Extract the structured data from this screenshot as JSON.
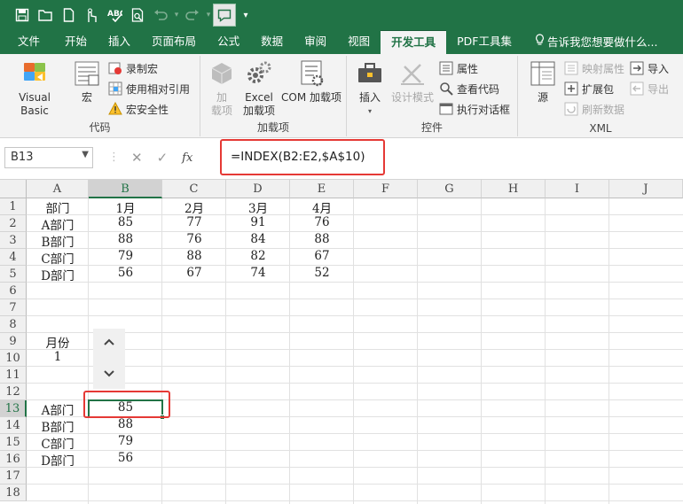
{
  "quick_access": {
    "icons": [
      "save-icon",
      "open-folder-icon",
      "new-file-icon",
      "touch-mode-icon",
      "spellcheck-icon",
      "print-preview-icon",
      "undo-icon",
      "redo-icon",
      "comment-icon",
      "customize-icon"
    ]
  },
  "ribbon_tabs": [
    {
      "label": "文件"
    },
    {
      "label": "开始"
    },
    {
      "label": "插入"
    },
    {
      "label": "页面布局"
    },
    {
      "label": "公式"
    },
    {
      "label": "数据"
    },
    {
      "label": "审阅"
    },
    {
      "label": "视图"
    },
    {
      "label": "开发工具",
      "active": true
    },
    {
      "label": "PDF工具集"
    },
    {
      "label": "告诉我您想要做什么..."
    }
  ],
  "ribbon": {
    "code_group": {
      "label": "代码",
      "visual_basic": "Visual Basic",
      "macro": "宏",
      "record_macro": "录制宏",
      "relative_ref": "使用相对引用",
      "macro_security": "宏安全性"
    },
    "addins_group": {
      "label": "加载项",
      "addins_line1": "加",
      "addins_line2": "载项",
      "excel_addins_line1": "Excel",
      "excel_addins_line2": "加载项",
      "com_addins": "COM 加载项"
    },
    "controls_group": {
      "label": "控件",
      "insert": "插入",
      "design_mode": "设计模式",
      "properties": "属性",
      "view_code": "查看代码",
      "run_dialog": "执行对话框"
    },
    "xml_group": {
      "label": "XML",
      "source": "源",
      "map_props": "映射属性",
      "expansion": "扩展包",
      "refresh": "刷新数据",
      "import": "导入",
      "export": "导出"
    }
  },
  "formula_bar": {
    "name_box": "B13",
    "cancel": "✕",
    "enter": "✓",
    "fx": "fx",
    "formula": "=INDEX(B2:E2,$A$10)"
  },
  "sheet": {
    "columns": [
      "A",
      "B",
      "C",
      "D",
      "E",
      "F",
      "G",
      "H",
      "I",
      "J"
    ],
    "rows": [
      "1",
      "2",
      "3",
      "4",
      "5",
      "6",
      "7",
      "8",
      "9",
      "10",
      "11",
      "12",
      "13",
      "14",
      "15",
      "16",
      "17",
      "18"
    ],
    "r1": [
      "部门",
      "1月",
      "2月",
      "3月",
      "4月"
    ],
    "r2": [
      "A部门",
      "85",
      "77",
      "91",
      "76"
    ],
    "r3": [
      "B部门",
      "88",
      "76",
      "84",
      "88"
    ],
    "r4": [
      "C部门",
      "79",
      "88",
      "82",
      "67"
    ],
    "r5": [
      "D部门",
      "56",
      "67",
      "74",
      "52"
    ],
    "a9": "月份",
    "a10": "1",
    "r13": [
      "A部门",
      "85"
    ],
    "r14": [
      "B部门",
      "88"
    ],
    "r15": [
      "C部门",
      "79"
    ],
    "r16": [
      "D部门",
      "56"
    ]
  },
  "spinner": {
    "up": "︿",
    "down": "﹀"
  },
  "colors": {
    "brand": "#217346",
    "highlight_box": "#e53935"
  }
}
